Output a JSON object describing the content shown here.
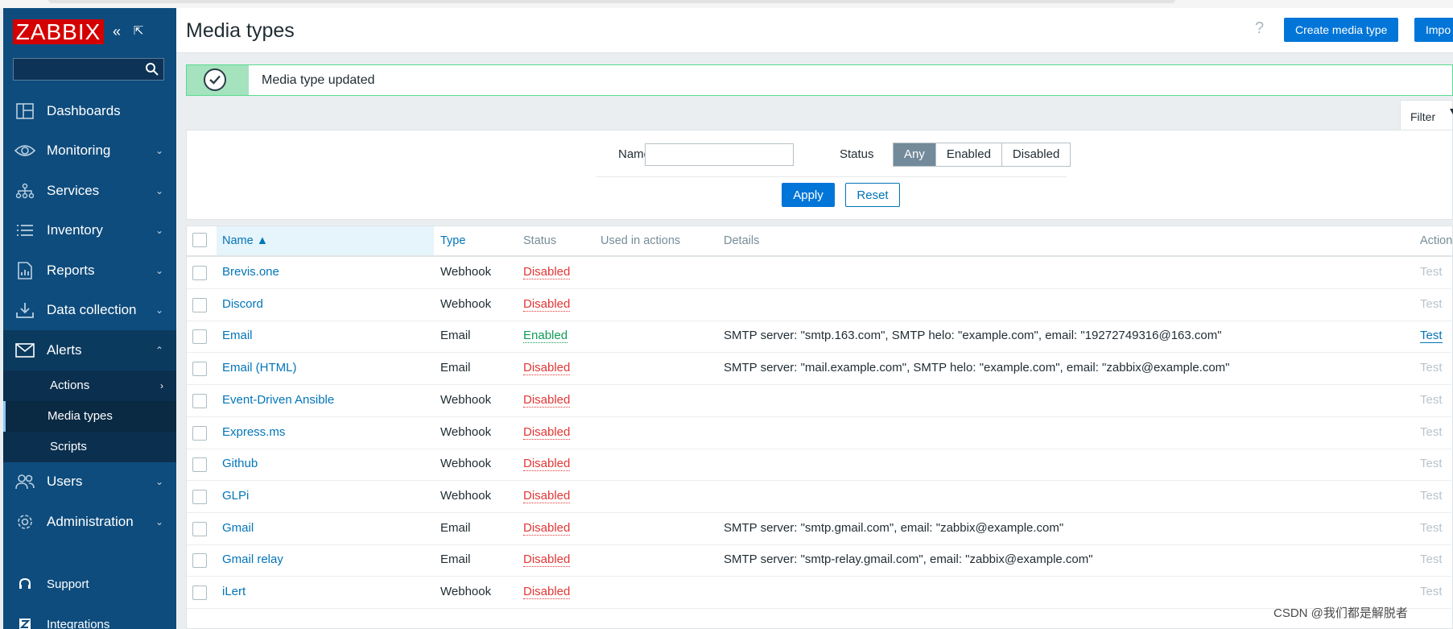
{
  "app": {
    "logo_text": "ZABBIX",
    "brand_color": "#d40000"
  },
  "sidebar": {
    "items": [
      {
        "label": "Dashboards",
        "icon": "dashboard-icon",
        "has_chevron": false
      },
      {
        "label": "Monitoring",
        "icon": "eye-icon",
        "has_chevron": true
      },
      {
        "label": "Services",
        "icon": "services-icon",
        "has_chevron": true
      },
      {
        "label": "Inventory",
        "icon": "list-icon",
        "has_chevron": true
      },
      {
        "label": "Reports",
        "icon": "report-icon",
        "has_chevron": true
      },
      {
        "label": "Data collection",
        "icon": "download-icon",
        "has_chevron": true
      },
      {
        "label": "Alerts",
        "icon": "envelope-icon",
        "has_chevron": true,
        "expanded": true
      },
      {
        "label": "Users",
        "icon": "users-icon",
        "has_chevron": true
      },
      {
        "label": "Administration",
        "icon": "gear-icon",
        "has_chevron": true
      }
    ],
    "alerts_sub": [
      {
        "label": "Actions",
        "has_chevron": true
      },
      {
        "label": "Media types",
        "active": true
      },
      {
        "label": "Scripts"
      }
    ],
    "bottom": [
      {
        "label": "Support",
        "icon": "headset-icon"
      },
      {
        "label": "Integrations",
        "icon": "integrations-icon"
      }
    ]
  },
  "header": {
    "title": "Media types",
    "help": "?",
    "create_button": "Create media type",
    "import_button": "Impo"
  },
  "message": {
    "text": "Media type updated"
  },
  "filter": {
    "tab_label": "Filter",
    "name_label": "Name",
    "name_value": "",
    "status_label": "Status",
    "status_options": [
      "Any",
      "Enabled",
      "Disabled"
    ],
    "status_selected": "Any",
    "apply_label": "Apply",
    "reset_label": "Reset"
  },
  "table": {
    "headers": {
      "name": "Name ▲",
      "type": "Type",
      "status": "Status",
      "used": "Used in actions",
      "details": "Details",
      "action": "Action"
    },
    "rows": [
      {
        "name": "Brevis.one",
        "type": "Webhook",
        "status": "Disabled",
        "details": "",
        "action": "Test"
      },
      {
        "name": "Discord",
        "type": "Webhook",
        "status": "Disabled",
        "details": "",
        "action": "Test"
      },
      {
        "name": "Email",
        "type": "Email",
        "status": "Enabled",
        "details": "SMTP server: \"smtp.163.com\", SMTP helo: \"example.com\", email: \"19272749316@163.com\"",
        "action": "Test"
      },
      {
        "name": "Email (HTML)",
        "type": "Email",
        "status": "Disabled",
        "details": "SMTP server: \"mail.example.com\", SMTP helo: \"example.com\", email: \"zabbix@example.com\"",
        "action": "Test"
      },
      {
        "name": "Event-Driven Ansible",
        "type": "Webhook",
        "status": "Disabled",
        "details": "",
        "action": "Test"
      },
      {
        "name": "Express.ms",
        "type": "Webhook",
        "status": "Disabled",
        "details": "",
        "action": "Test"
      },
      {
        "name": "Github",
        "type": "Webhook",
        "status": "Disabled",
        "details": "",
        "action": "Test"
      },
      {
        "name": "GLPi",
        "type": "Webhook",
        "status": "Disabled",
        "details": "",
        "action": "Test"
      },
      {
        "name": "Gmail",
        "type": "Email",
        "status": "Disabled",
        "details": "SMTP server: \"smtp.gmail.com\", email: \"zabbix@example.com\"",
        "action": "Test"
      },
      {
        "name": "Gmail relay",
        "type": "Email",
        "status": "Disabled",
        "details": "SMTP server: \"smtp-relay.gmail.com\", email: \"zabbix@example.com\"",
        "action": "Test"
      },
      {
        "name": "iLert",
        "type": "Webhook",
        "status": "Disabled",
        "details": "",
        "action": "Test"
      }
    ]
  },
  "watermark": "CSDN @我们都是解脱者"
}
